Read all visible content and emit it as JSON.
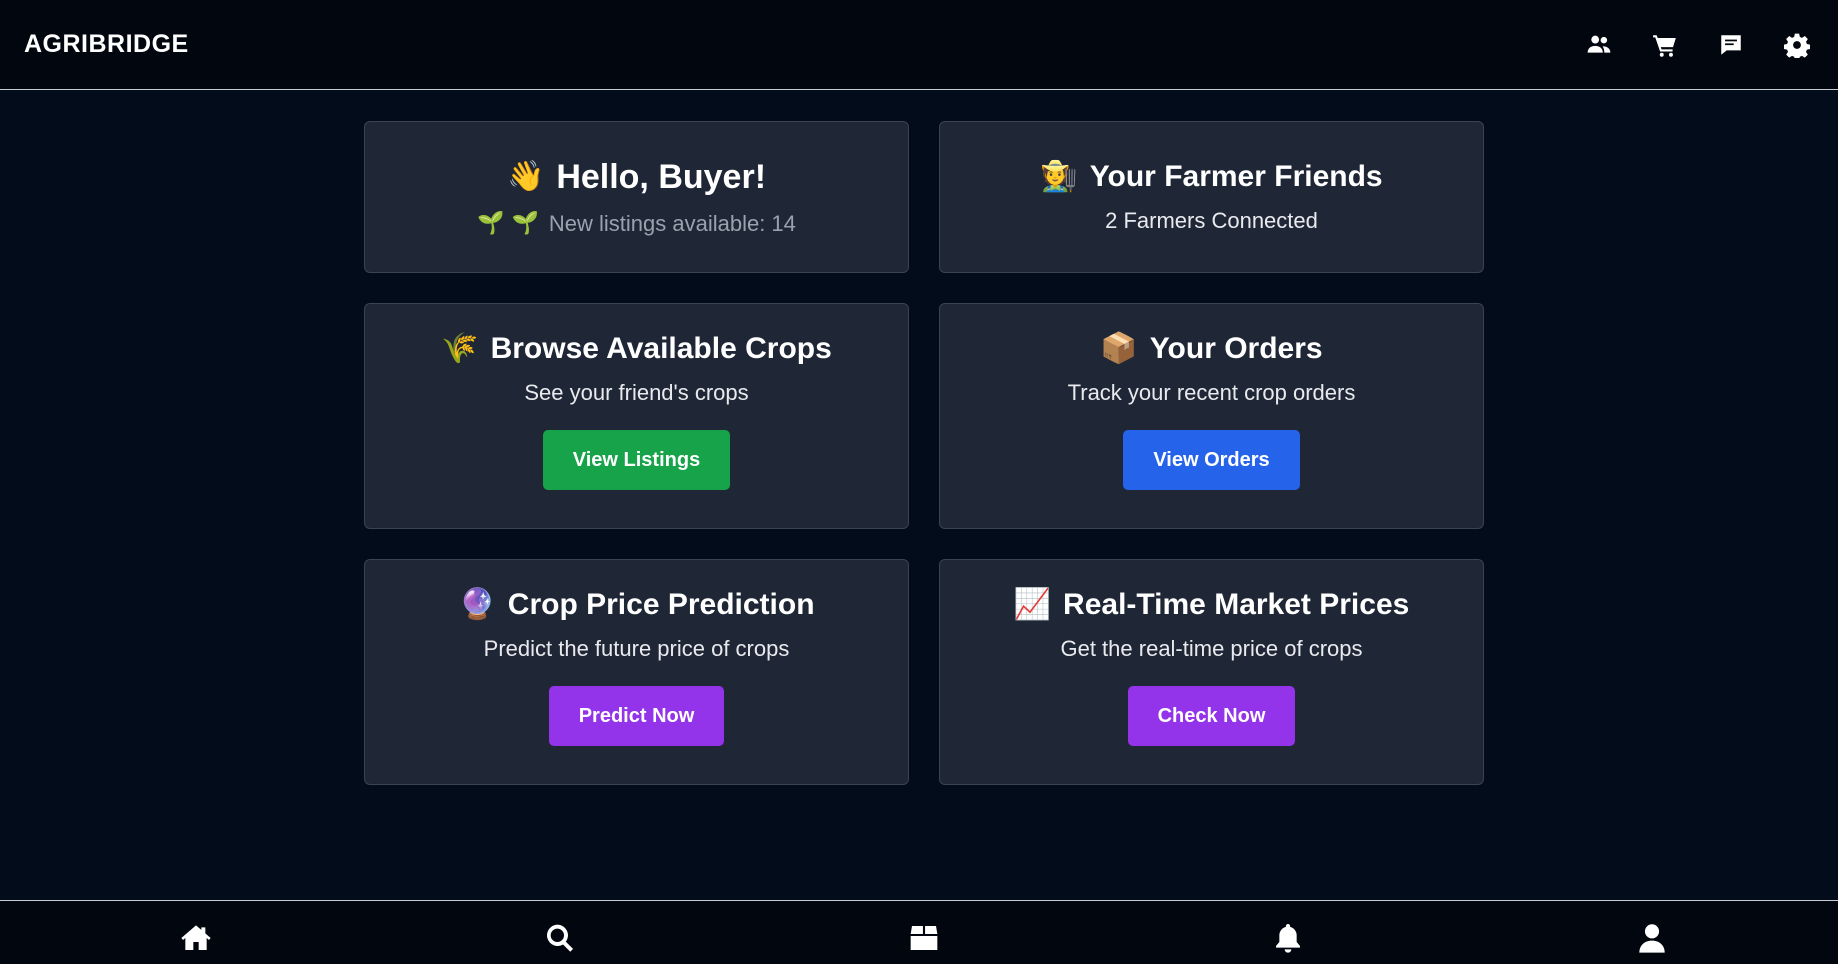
{
  "app": {
    "brand": "AGRIBRIDGE"
  },
  "header_icons": [
    "friends-icon",
    "cart-icon",
    "chat-icon",
    "gear-icon"
  ],
  "cards": {
    "hello": {
      "emoji": "👋",
      "title": "Hello, Buyer!",
      "sprouts": "🌱 🌱",
      "subtitle": "New listings available: 14"
    },
    "friends": {
      "emoji": "🧑‍🌾",
      "title": "Your Farmer Friends",
      "subtitle": "2 Farmers Connected"
    },
    "browse": {
      "emoji": "🌾",
      "title": "Browse Available Crops",
      "subtitle": "See your friend's crops",
      "button": "View Listings"
    },
    "orders": {
      "emoji": "📦",
      "title": "Your Orders",
      "subtitle": "Track your recent crop orders",
      "button": "View Orders"
    },
    "prediction": {
      "emoji": "🔮",
      "title": "Crop Price Prediction",
      "subtitle": "Predict the future price of crops",
      "button": "Predict Now"
    },
    "market": {
      "emoji": "📈",
      "title": "Real-Time Market Prices",
      "subtitle": "Get the real-time price of crops",
      "button": "Check Now"
    }
  },
  "bottom_nav": [
    "home-icon",
    "search-icon",
    "box-icon",
    "bell-icon",
    "user-icon"
  ],
  "colors": {
    "background": "#020c1b",
    "card": "#1f2736",
    "green": "#16a34a",
    "blue": "#2563eb",
    "purple": "#9333ea"
  }
}
